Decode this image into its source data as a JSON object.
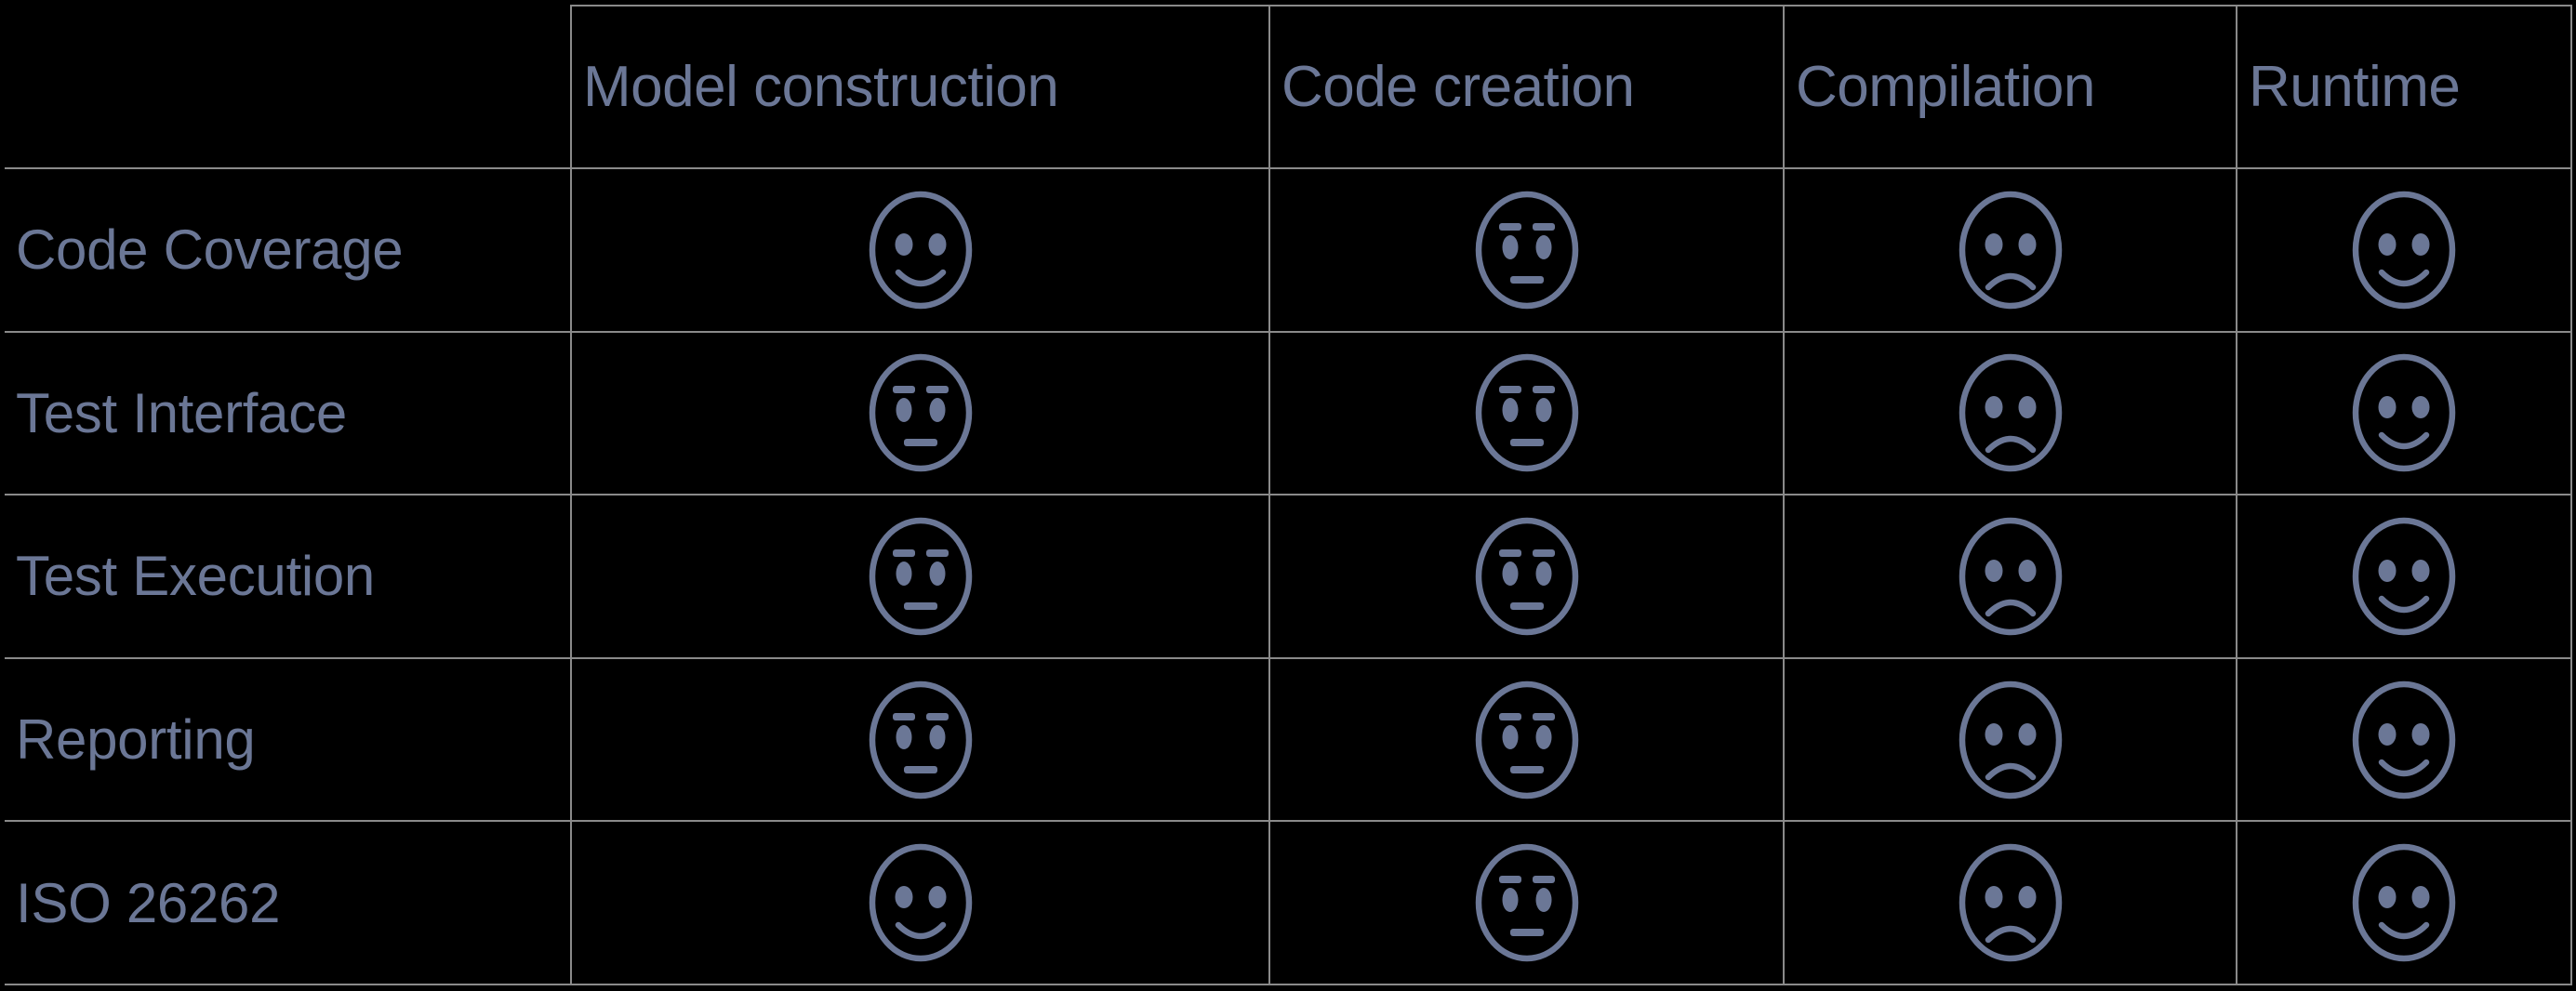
{
  "table": {
    "corner_label": "",
    "columns": [
      {
        "id": "label",
        "label": ""
      },
      {
        "id": "model",
        "label": "Model construction"
      },
      {
        "id": "code",
        "label": "Code creation"
      },
      {
        "id": "comp",
        "label": "Compilation"
      },
      {
        "id": "run",
        "label": "Runtime"
      }
    ],
    "rows": [
      {
        "label": "Code Coverage",
        "ratings": [
          "happy",
          "neutral",
          "sad",
          "happy"
        ]
      },
      {
        "label": "Test Interface",
        "ratings": [
          "neutral",
          "neutral",
          "sad",
          "happy"
        ]
      },
      {
        "label": "Test Execution",
        "ratings": [
          "neutral",
          "neutral",
          "sad",
          "happy"
        ]
      },
      {
        "label": "Reporting",
        "ratings": [
          "neutral",
          "neutral",
          "sad",
          "happy"
        ]
      },
      {
        "label": "ISO 26262",
        "ratings": [
          "happy",
          "neutral",
          "sad",
          "happy"
        ]
      }
    ],
    "icons": {
      "happy": "happy-face-icon",
      "neutral": "neutral-face-icon",
      "sad": "sad-face-icon"
    }
  },
  "colors": {
    "background": "#000000",
    "text": "#6b7796",
    "icon": "#6b7796",
    "grid_line": "#8a8a8a"
  }
}
